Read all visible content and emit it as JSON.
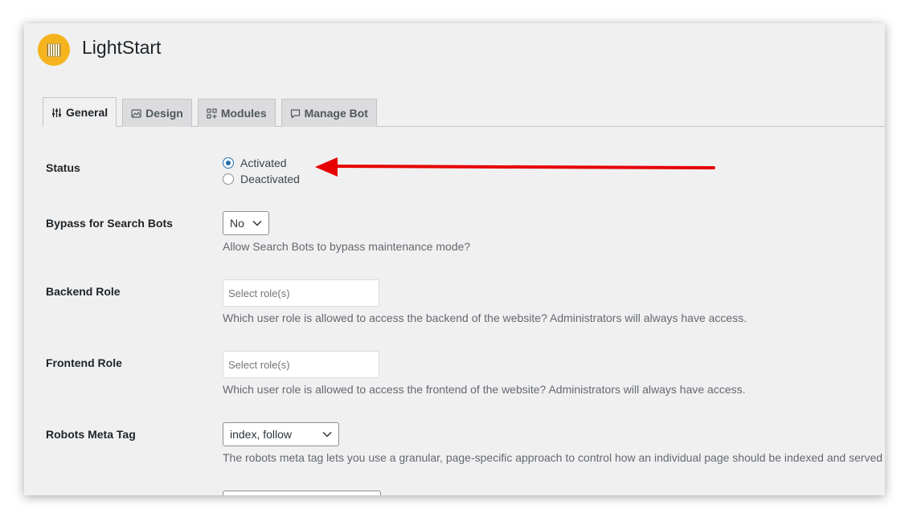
{
  "app": {
    "title": "LightStart",
    "logo_icon": "lightstart-logo-icon"
  },
  "tabs": [
    {
      "label": "General",
      "icon": "sliders-icon",
      "active": true
    },
    {
      "label": "Design",
      "icon": "image-icon",
      "active": false
    },
    {
      "label": "Modules",
      "icon": "modules-icon",
      "active": false
    },
    {
      "label": "Manage Bot",
      "icon": "chat-icon",
      "active": false
    }
  ],
  "fields": {
    "status": {
      "label": "Status",
      "options": [
        "Activated",
        "Deactivated"
      ],
      "selected": "Activated"
    },
    "bypass": {
      "label": "Bypass for Search Bots",
      "value": "No",
      "description": "Allow Search Bots to bypass maintenance mode?"
    },
    "backend_role": {
      "label": "Backend Role",
      "placeholder": "Select role(s)",
      "description": "Which user role is allowed to access the backend of the website? Administrators will always have access."
    },
    "frontend_role": {
      "label": "Frontend Role",
      "placeholder": "Select role(s)",
      "description": "Which user role is allowed to access the frontend of the website? Administrators will always have access."
    },
    "robots": {
      "label": "Robots Meta Tag",
      "value": "index, follow",
      "description": "The robots meta tag lets you use a granular, page-specific approach to control how an individual page should be indexed and served t"
    }
  },
  "colors": {
    "accent": "#2271b1",
    "annotation_arrow": "#e60000",
    "logo": "#f5b41e"
  }
}
